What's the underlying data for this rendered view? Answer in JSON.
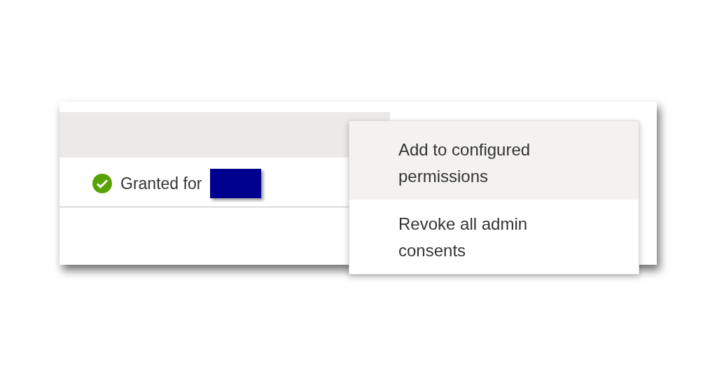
{
  "row": {
    "status": "Granted for",
    "granted": true
  },
  "menu": {
    "items": [
      {
        "label": "Add to configured permissions",
        "selected": true
      },
      {
        "label": "Revoke all admin consents",
        "selected": false
      }
    ]
  }
}
